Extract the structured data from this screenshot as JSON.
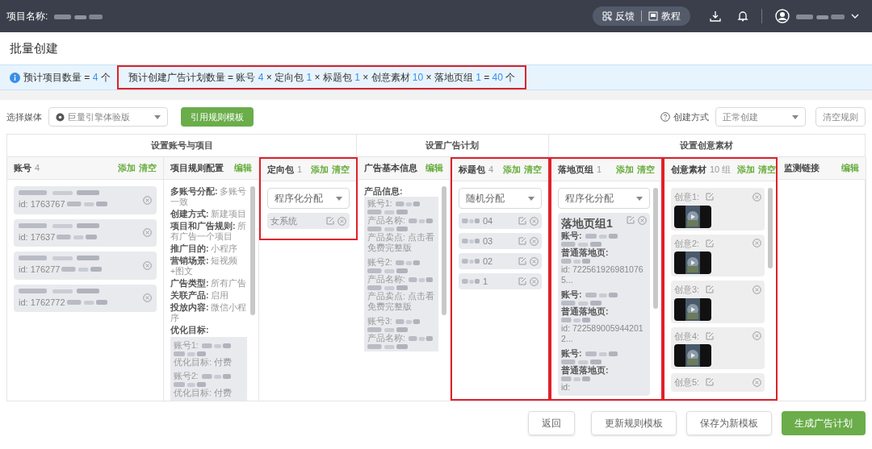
{
  "topbar": {
    "project_label": "项目名称:",
    "feedback": "反馈",
    "tutorial": "教程"
  },
  "page_title": "批量创建",
  "summary": {
    "project_parts": [
      {
        "kind": "text",
        "text": "预计项目数量 = "
      },
      {
        "kind": "number",
        "text": "4"
      },
      {
        "kind": "text",
        "text": " 个"
      }
    ],
    "highlighted": true,
    "plan_parts": [
      {
        "kind": "text",
        "text": "预计创建广告计划数量 = 账号 "
      },
      {
        "kind": "number",
        "text": "4"
      },
      {
        "kind": "text",
        "text": " × 定向包 "
      },
      {
        "kind": "number",
        "text": "1"
      },
      {
        "kind": "text",
        "text": " × 标题包 "
      },
      {
        "kind": "number",
        "text": "1"
      },
      {
        "kind": "text",
        "text": " × 创意素材 "
      },
      {
        "kind": "number",
        "text": "10"
      },
      {
        "kind": "text",
        "text": " × 落地页组 "
      },
      {
        "kind": "number",
        "text": "1"
      },
      {
        "kind": "text",
        "text": " = "
      },
      {
        "kind": "number",
        "text": "40"
      },
      {
        "kind": "text",
        "text": " 个"
      }
    ]
  },
  "toolbar": {
    "media_label": "选择媒体",
    "media_value": "巨量引擎体验版",
    "template_button": "引用规则模板",
    "mode_label": "创建方式",
    "mode_value": "正常创建",
    "clear_button": "清空规则"
  },
  "groups": [
    "设置账号与项目",
    "设置广告计划",
    "设置创意素材"
  ],
  "columns": [
    {
      "kind": "accounts",
      "title": "账号",
      "count": "4",
      "highlighted": false,
      "actions": [
        "添加",
        "清空"
      ],
      "items": [
        {
          "id": "id: 1763767"
        },
        {
          "id": "id: 17637"
        },
        {
          "id": "id: 176277"
        },
        {
          "id": "id: 1762772"
        }
      ]
    },
    {
      "kind": "rules",
      "title": "项目规则配置",
      "highlighted": false,
      "actions": [
        "编辑"
      ],
      "fields": [
        {
          "label": "多账号分配:",
          "value": "多账号一致"
        },
        {
          "label": "创建方式:",
          "value": "新建项目"
        },
        {
          "label": "项目和广告规则:",
          "value": "所有广告一个项目"
        },
        {
          "label": "推广目的:",
          "value": "小程序"
        },
        {
          "label": "营销场景:",
          "value": "短视频+图文"
        },
        {
          "label": "广告类型:",
          "value": "所有广告"
        },
        {
          "label": "关联产品:",
          "value": "启用"
        },
        {
          "label": "投放内容:",
          "value": "微信小程序"
        },
        {
          "label": "优化目标:"
        }
      ],
      "sub": [
        {
          "account": "账号1:",
          "goal": "优化目标: 付费"
        },
        {
          "account": "账号2:",
          "goal": "优化目标: 付费"
        }
      ]
    },
    {
      "kind": "list",
      "title": "定向包",
      "count": "1",
      "highlighted": true,
      "actions": [
        "添加",
        "清空"
      ],
      "select": "程序化分配",
      "items": [
        {
          "text": "女系统",
          "blurred": false
        }
      ]
    },
    {
      "kind": "info",
      "title": "广告基本信息",
      "highlighted": false,
      "actions": [
        "编辑"
      ],
      "heading": "产品信息:",
      "entries": [
        {
          "lines": [
            {
              "label": "账号1:"
            },
            {
              "label": "产品名称:"
            },
            {
              "label": "产品卖点:",
              "value": "点击看免费完整版"
            }
          ]
        },
        {
          "lines": [
            {
              "label": "账号2:"
            },
            {
              "label": "产品名称:"
            },
            {
              "label": "产品卖点:",
              "value": "点击看免费完整版"
            }
          ]
        },
        {
          "lines": [
            {
              "label": "账号3:"
            },
            {
              "label": "产品名称:"
            }
          ]
        }
      ]
    },
    {
      "kind": "list",
      "title": "标题包",
      "count": "4",
      "highlighted": true,
      "actions": [
        "添加",
        "清空"
      ],
      "select": "随机分配",
      "items": [
        {
          "text": "04",
          "blurred": true
        },
        {
          "text": "03",
          "blurred": true
        },
        {
          "text": "02",
          "blurred": true
        },
        {
          "text": "1",
          "blurred": true
        }
      ]
    },
    {
      "kind": "landing",
      "title": "落地页组",
      "count": "1",
      "highlighted": true,
      "actions": [
        "添加",
        "清空"
      ],
      "select": "程序化分配",
      "card_title": "落地页组1",
      "entries": [
        {
          "account": "账号:",
          "page": "普通落地页:",
          "id": "id: 7225619269810765..."
        },
        {
          "account": "账号:",
          "page": "普通落地页:",
          "id": "id: 7225890059442012..."
        },
        {
          "account": "账号:",
          "page": "普通落地页:",
          "id": "id:"
        }
      ]
    },
    {
      "kind": "creatives",
      "title": "创意素材",
      "count": "10 组",
      "highlighted": true,
      "actions": [
        "添加",
        "清空"
      ],
      "items": [
        {
          "label": "创意1:",
          "thumb": true
        },
        {
          "label": "创意2:",
          "thumb": true
        },
        {
          "label": "创意3:",
          "thumb": true
        },
        {
          "label": "创意4:",
          "thumb": true
        },
        {
          "label": "创意5:",
          "thumb": false
        }
      ]
    },
    {
      "kind": "empty",
      "title": "监测链接",
      "highlighted": false,
      "actions": [
        "编辑"
      ]
    }
  ],
  "footer_buttons": [
    {
      "label": "返回",
      "primary": false
    },
    {
      "label": "更新规则模板",
      "primary": false
    },
    {
      "label": "保存为新模板",
      "primary": false
    },
    {
      "label": "生成广告计划",
      "primary": true
    }
  ]
}
